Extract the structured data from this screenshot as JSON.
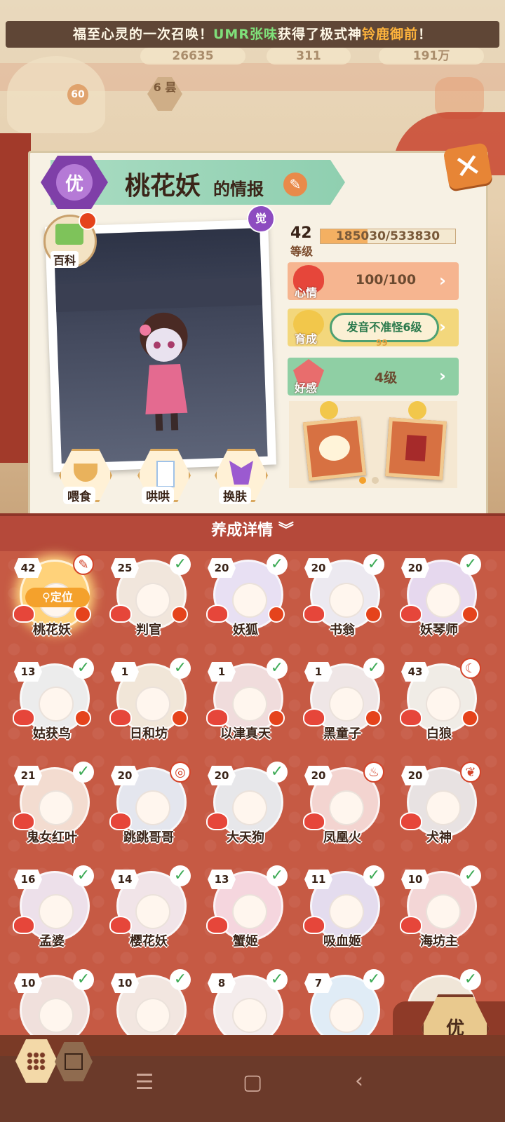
{
  "ticker": {
    "part1": "福至心灵的一次召唤！",
    "player": "UMR张味",
    "part2": "获得了极式神",
    "reward": "铃鹿御前",
    "part3": "！"
  },
  "resources": {
    "r1": "26635",
    "r2": "311",
    "r3": "191万"
  },
  "player_level": "60",
  "day_ticket": "6 昙",
  "card": {
    "rarity": "优",
    "name": "桃花妖",
    "name_suffix": "的情报",
    "wiki_label": "百科",
    "awaken_label": "觉",
    "level": "42",
    "level_label": "等级",
    "xp": "185030/533830",
    "xp_fraction": 0.347,
    "mood_label": "心情",
    "mood_value": "100/100",
    "growth_label": "育成",
    "growth_value": "发音不准怪6级",
    "growth_sub": "99",
    "favor_label": "好感",
    "favor_value": "4级",
    "actions": [
      {
        "label": "喂食",
        "icon": "noodle-bowl-icon"
      },
      {
        "label": "哄哄",
        "icon": "milk-carton-icon"
      },
      {
        "label": "换肤",
        "icon": "skin-icon"
      }
    ]
  },
  "detail_label": "养成详情",
  "shikigami": [
    {
      "name": "桃花妖",
      "level": "42",
      "status": "note"
    },
    {
      "name": "判官",
      "level": "25",
      "status": "check"
    },
    {
      "name": "妖狐",
      "level": "20",
      "status": "check"
    },
    {
      "name": "书翁",
      "level": "20",
      "status": "check"
    },
    {
      "name": "妖琴师",
      "level": "20",
      "status": "check"
    },
    {
      "name": "姑获鸟",
      "level": "13",
      "status": "check"
    },
    {
      "name": "日和坊",
      "level": "1",
      "status": "check"
    },
    {
      "name": "以津真天",
      "level": "1",
      "status": "check"
    },
    {
      "name": "黑童子",
      "level": "1",
      "status": "check"
    },
    {
      "name": "白狼",
      "level": "43",
      "status": "moon"
    },
    {
      "name": "鬼女红叶",
      "level": "21",
      "status": "check"
    },
    {
      "name": "跳跳哥哥",
      "level": "20",
      "status": "spiral"
    },
    {
      "name": "大天狗",
      "level": "20",
      "status": "check"
    },
    {
      "name": "凤凰火",
      "level": "20",
      "status": "chef"
    },
    {
      "name": "犬神",
      "level": "20",
      "status": "leaf"
    },
    {
      "name": "孟婆",
      "level": "16",
      "status": "check"
    },
    {
      "name": "樱花妖",
      "level": "14",
      "status": "check"
    },
    {
      "name": "蟹姬",
      "level": "13",
      "status": "check"
    },
    {
      "name": "吸血姬",
      "level": "11",
      "status": "check"
    },
    {
      "name": "海坊主",
      "level": "10",
      "status": "check"
    },
    {
      "name": "",
      "level": "10",
      "status": "check"
    },
    {
      "name": "",
      "level": "10",
      "status": "check"
    },
    {
      "name": "",
      "level": "8",
      "status": "check"
    },
    {
      "name": "",
      "level": "7",
      "status": "check"
    },
    {
      "name": "",
      "level": "",
      "status": "check"
    }
  ],
  "locate_label": "定位",
  "rarity_filter": "优",
  "colors": {
    "accent": "#c65a44",
    "check": "#3caa55",
    "alert": "#e5431c"
  }
}
